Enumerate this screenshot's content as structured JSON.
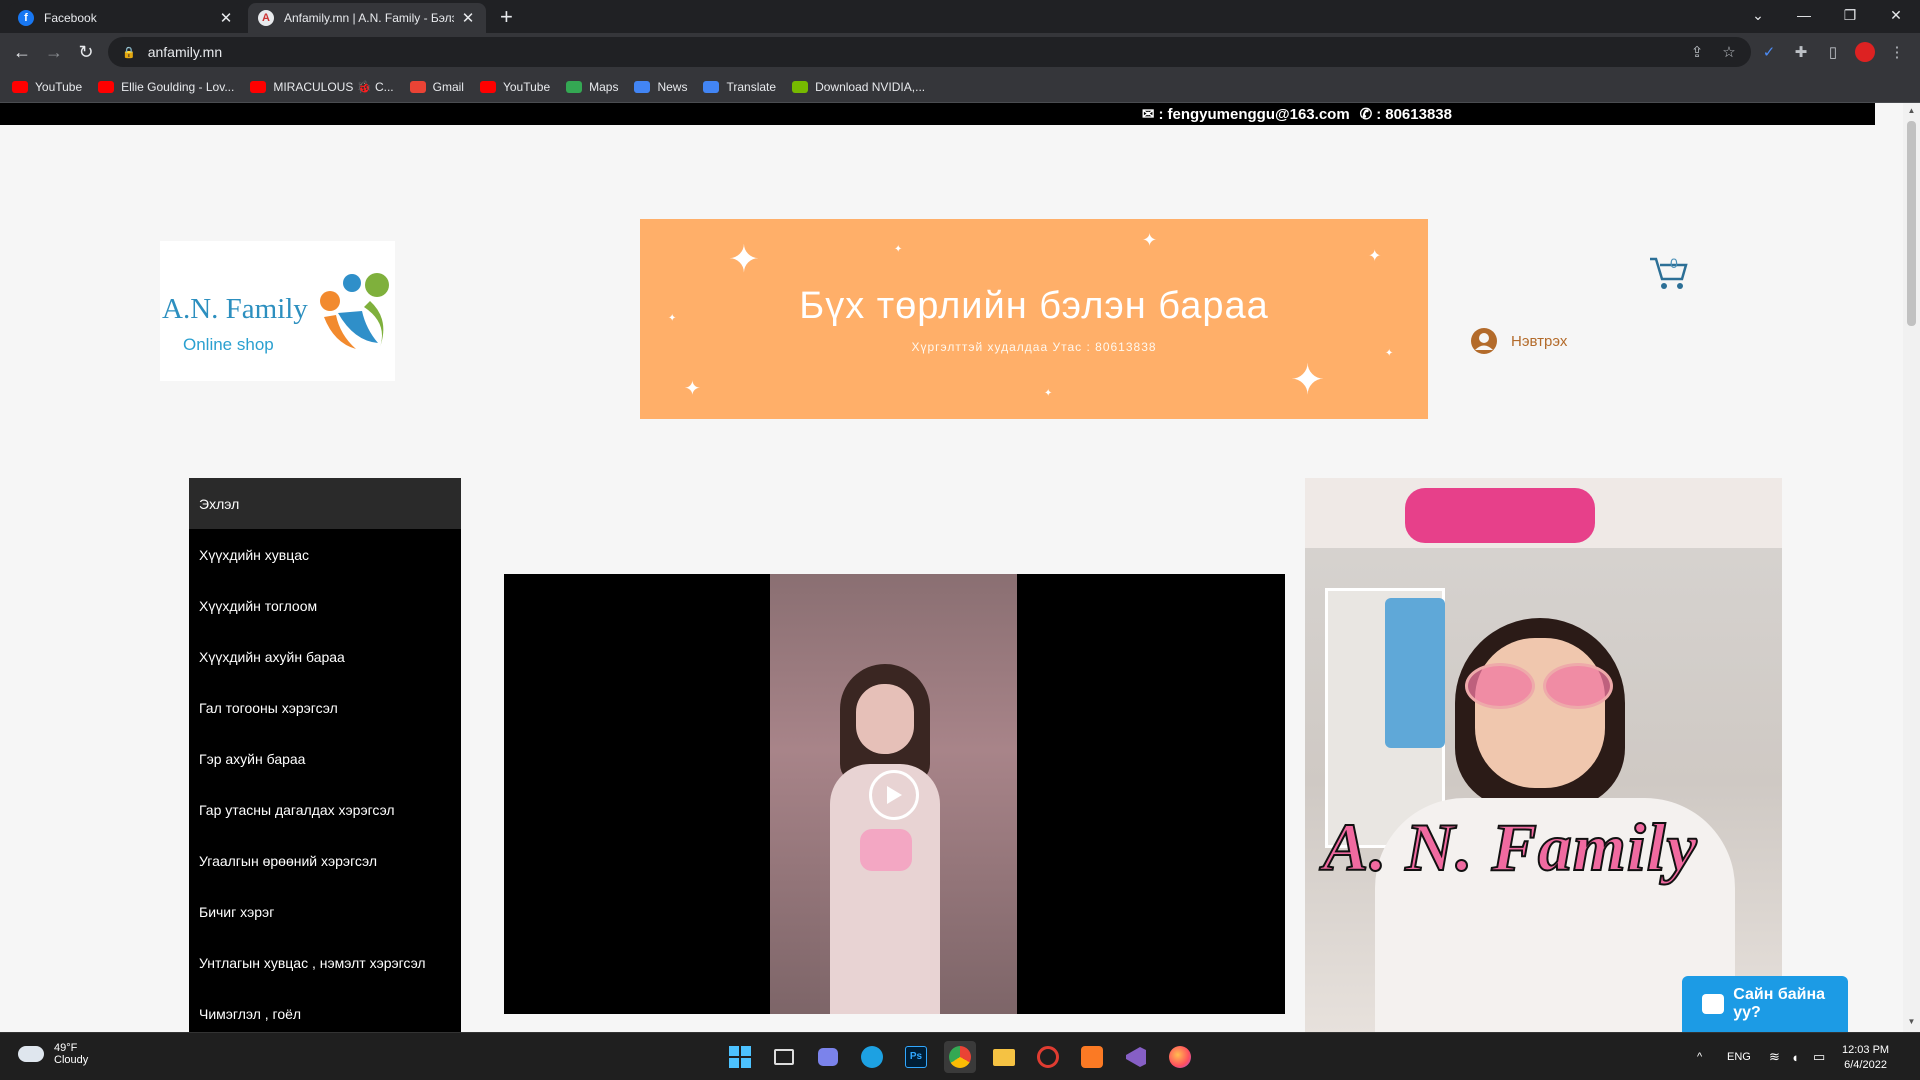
{
  "browser": {
    "tabs": [
      {
        "title": "Facebook",
        "favicon": "f",
        "favicon_color": "#1877f2"
      },
      {
        "title": "Anfamily.mn | A.N. Family - Бэлэн",
        "favicon": "A",
        "favicon_color": "#e8eaed"
      }
    ],
    "new_tab": "+",
    "url": "anfamily.mn",
    "bookmarks": [
      {
        "label": "YouTube",
        "icon": "youtube-icon",
        "color": "#ff0000"
      },
      {
        "label": "Ellie Goulding - Lov...",
        "icon": "youtube-icon",
        "color": "#ff0000"
      },
      {
        "label": "MIRACULOUS 🐞 C...",
        "icon": "youtube-icon",
        "color": "#ff0000"
      },
      {
        "label": "Gmail",
        "icon": "gmail-icon",
        "color": "#ea4335"
      },
      {
        "label": "YouTube",
        "icon": "youtube-icon",
        "color": "#ff0000"
      },
      {
        "label": "Maps",
        "icon": "maps-icon",
        "color": "#34a853"
      },
      {
        "label": "News",
        "icon": "news-icon",
        "color": "#4285f4"
      },
      {
        "label": "Translate",
        "icon": "translate-icon",
        "color": "#4285f4"
      },
      {
        "label": "Download NVIDIA,...",
        "icon": "nvidia-icon",
        "color": "#76b900"
      }
    ]
  },
  "site": {
    "contact_email": "fengyumenggu@163.com",
    "contact_phone": "80613838",
    "contact_sep": ":",
    "logo": {
      "title": "A.N. Family",
      "subtitle": "Online shop"
    },
    "banner": {
      "title": "Бүх төрлийн бэлэн бараа",
      "subtitle": "Хүргэлттэй худалдаа Утас : 80613838"
    },
    "cart_count": "0",
    "login_label": "Нэвтрэх",
    "menu": [
      "Эхлэл",
      "Хүүхдийн хувцас",
      "Хүүхдийн тоглоом",
      "Хүүхдийн ахуйн бараа",
      "Гал тогооны хэрэгсэл",
      "Гэр ахуйн бараа",
      "Гар утасны дагалдах хэрэгсэл",
      "Угаалгын өрөөний хэрэгсэл",
      "Бичиг хэрэг",
      "Унтлагын хувцас , нэмэлт хэрэгсэл",
      "Чимэглэл , гоёл"
    ],
    "photo_brand": "A. N. Family",
    "chat_label": "Сайн байна уу?"
  },
  "taskbar": {
    "weather_temp": "49°F",
    "weather_desc": "Cloudy",
    "language": "ENG",
    "time": "12:03 PM",
    "date": "6/4/2022"
  },
  "colors": {
    "banner": "#ffaf69",
    "chat": "#1c9be5",
    "login": "#b36b2b"
  }
}
